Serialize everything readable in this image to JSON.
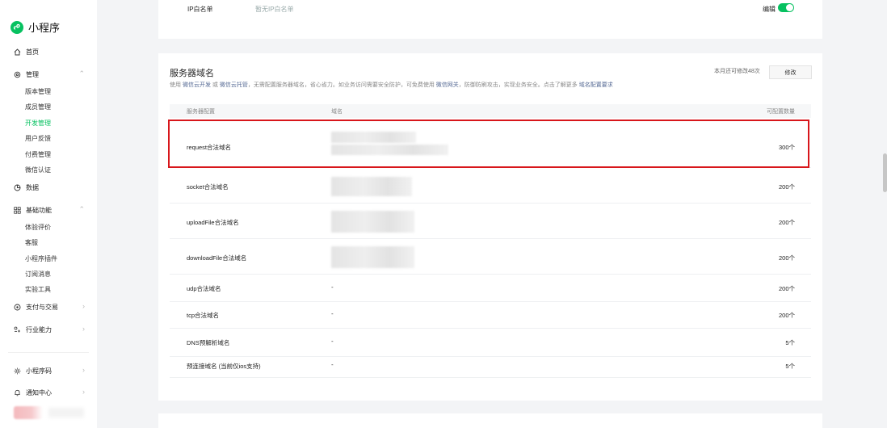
{
  "app": {
    "title": "小程序"
  },
  "sidebar": {
    "home": "首页",
    "manage": "管理",
    "manage_items": [
      "版本管理",
      "成员管理",
      "开发管理",
      "用户反馈",
      "付费管理",
      "微信认证"
    ],
    "data": "数据",
    "basic": "基础功能",
    "basic_items": [
      "体验评价",
      "客服",
      "小程序插件",
      "订阅消息",
      "实验工具"
    ],
    "pay": "支付与交易",
    "industry": "行业能力",
    "qrcode": "小程序码",
    "notify": "通知中心",
    "active_item": "开发管理"
  },
  "ip_whitelist": {
    "label": "IP白名单",
    "value": "暂无IP白名单",
    "edit_label": "编辑",
    "toggle_on": true
  },
  "server_domain": {
    "title": "服务器域名",
    "desc_parts": [
      "使用 ",
      "微信云开发",
      " 或 ",
      "微信云托管",
      "，无需配置服务器域名，省心省力。如业务访问需要安全防护，可免费使用 ",
      "微信网关",
      "，防御防刷攻击，实现业务安全。点击了解更多 ",
      "域名配置要求"
    ],
    "remain_text": "本月还可修改48次",
    "modify_label": "修改",
    "columns": [
      "服务器配置",
      "域名",
      "可配置数量"
    ],
    "rows": [
      {
        "name": "request合法域名",
        "domain": "",
        "count": "300个"
      },
      {
        "name": "socket合法域名",
        "domain": "",
        "count": "200个"
      },
      {
        "name": "uploadFile合法域名",
        "domain": "",
        "count": "200个"
      },
      {
        "name": "downloadFile合法域名",
        "domain": "",
        "count": "200个"
      },
      {
        "name": "udp合法域名",
        "domain": "-",
        "count": "200个"
      },
      {
        "name": "tcp合法域名",
        "domain": "-",
        "count": "200个"
      },
      {
        "name": "DNS预解析域名",
        "domain": "-",
        "count": "5个"
      },
      {
        "name": "预连接域名 (当前仅ios支持)",
        "domain": "-",
        "count": "5个"
      }
    ]
  },
  "colors": {
    "accent": "#07c160",
    "highlight": "#d8161b",
    "link": "#576b95"
  }
}
